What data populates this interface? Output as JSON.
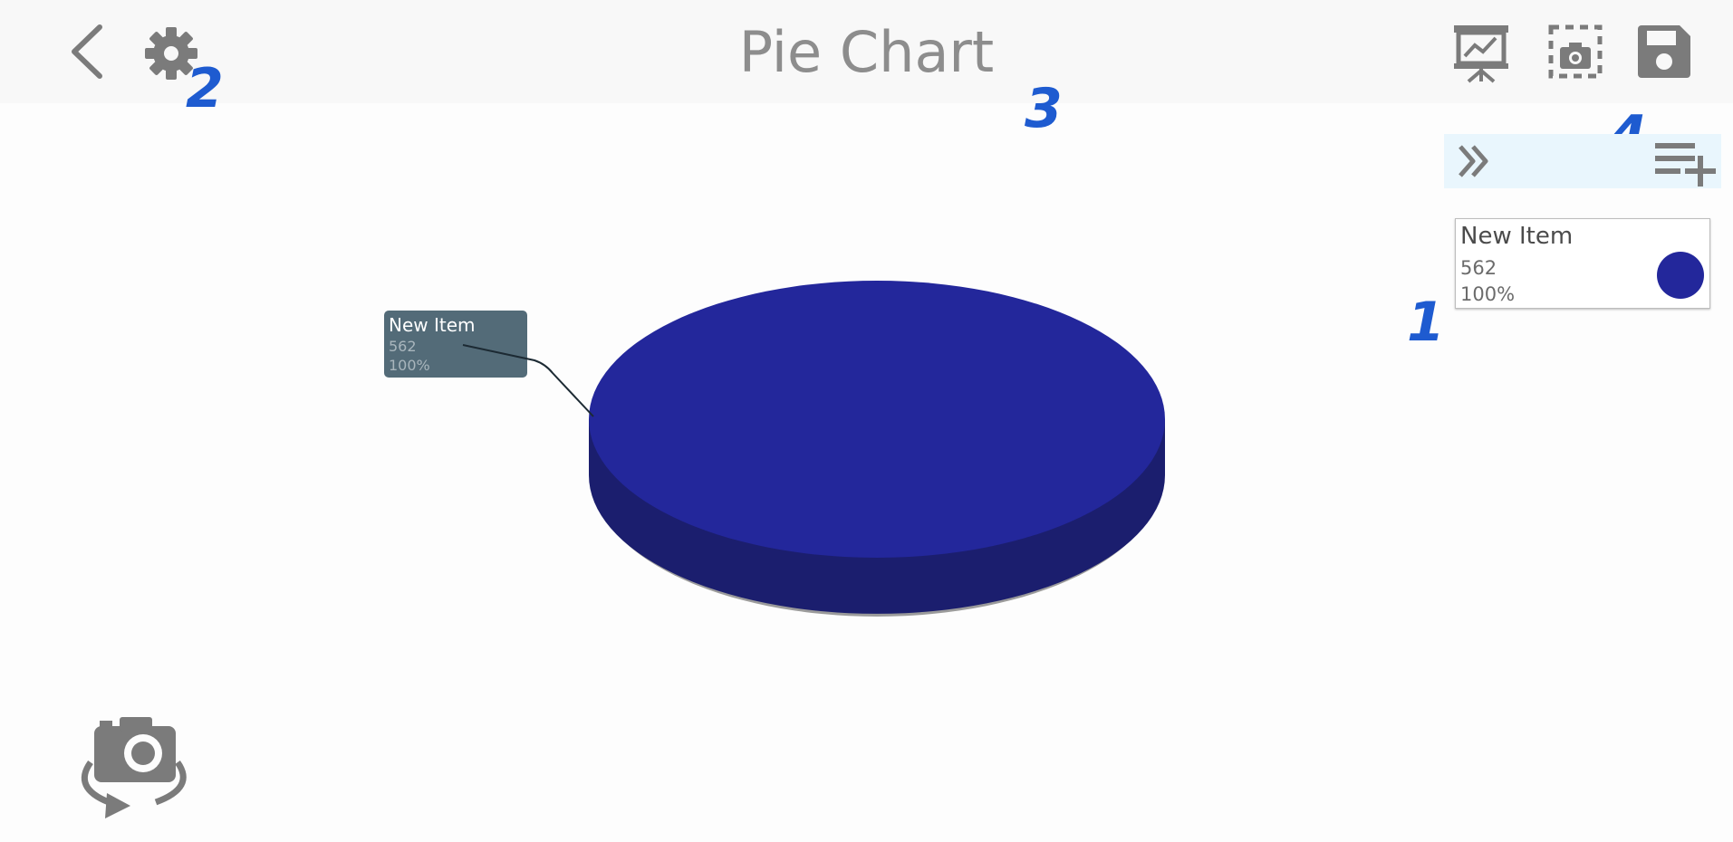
{
  "header": {
    "title": "Pie Chart",
    "icons": [
      "back-chevron-icon",
      "gear-icon",
      "presentation-icon",
      "screenshot-icon",
      "save-icon"
    ]
  },
  "annotations": [
    "1",
    "2",
    "3",
    "4"
  ],
  "panel": {
    "icons": [
      "double-chevron-right-icon",
      "add-list-item-icon"
    ],
    "accent": "#e9f6fd"
  },
  "legend": [
    {
      "name": "New Item",
      "value": "562",
      "percent": "100%",
      "color": "#23279b"
    }
  ],
  "tooltip": {
    "name": "New Item",
    "value": "562",
    "percent": "100%"
  },
  "camera_button": {
    "icon": "rotate-camera-icon"
  },
  "colors": {
    "pie_top": "#23279b",
    "pie_side": "#1b1e6e",
    "icon_gray": "#7b7b7b"
  },
  "chart_data": {
    "type": "pie",
    "title": "Pie Chart",
    "categories": [
      "New Item"
    ],
    "values": [
      562
    ],
    "percentages": [
      100
    ],
    "style": "3d"
  }
}
